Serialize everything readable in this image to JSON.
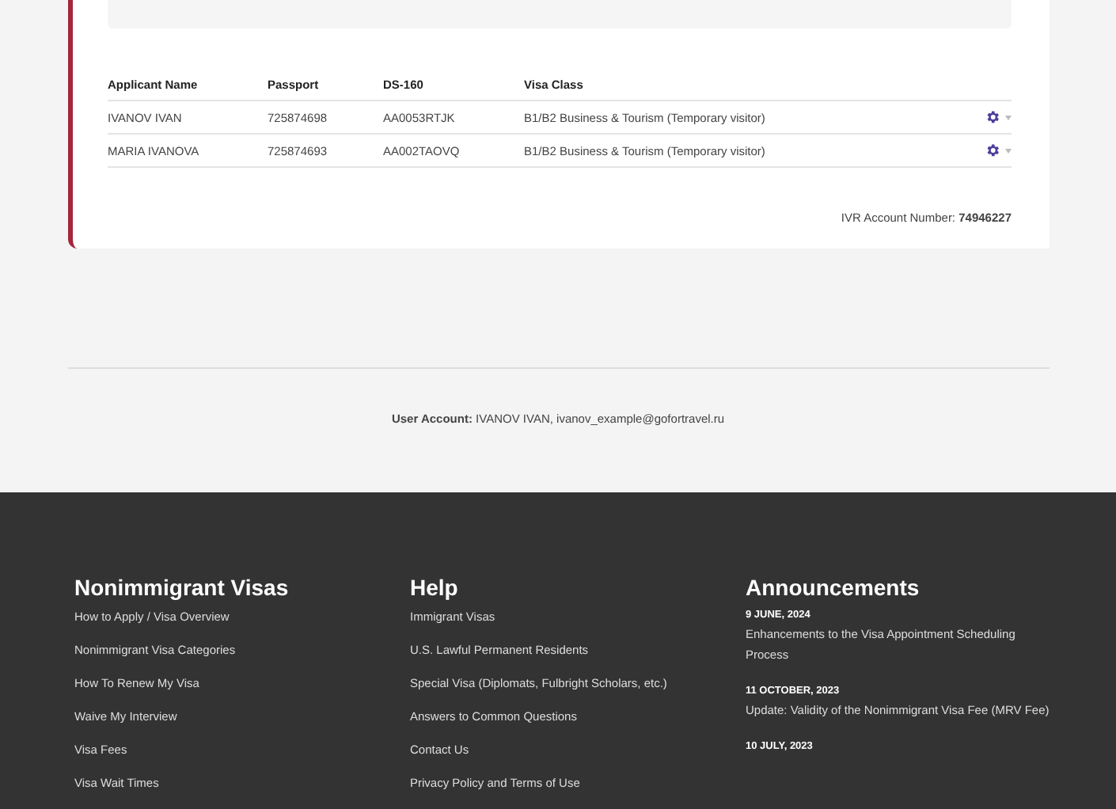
{
  "table": {
    "columns": [
      "Applicant Name",
      "Passport",
      "DS-160",
      "Visa Class"
    ],
    "rows": [
      {
        "cells": [
          "IVANOV IVAN",
          "725874698",
          "AA0053RTJK",
          "B1/B2 Business & Tourism (Temporary visitor)"
        ]
      },
      {
        "cells": [
          "MARIA IVANOVA",
          "725874693",
          "AA002TAOVQ",
          "B1/B2 Business & Tourism (Temporary visitor)"
        ]
      }
    ]
  },
  "ivr": {
    "label": "IVR Account Number:",
    "value": "74946227"
  },
  "user_account": {
    "label": "User Account:",
    "value": "IVANOV IVAN, ivanov_example@gofortravel.ru"
  },
  "footer": {
    "columns": [
      {
        "title": "Nonimmigrant Visas",
        "links": [
          "How to Apply / Visa Overview",
          "Nonimmigrant Visa Categories",
          "How To Renew My Visa",
          "Waive My Interview",
          "Visa Fees",
          "Visa Wait Times"
        ]
      },
      {
        "title": "Help",
        "links": [
          "Immigrant Visas",
          "U.S. Lawful Permanent Residents",
          "Special Visa (Diplomats, Fulbright Scholars, etc.)",
          "Answers to Common Questions",
          "Contact Us",
          "Privacy Policy and Terms of Use"
        ]
      }
    ],
    "announcements": {
      "title": "Announcements",
      "items": [
        {
          "date": "9 JUNE, 2024",
          "text": "Enhancements to the Visa Appointment Scheduling Process"
        },
        {
          "date": "11 OCTOBER, 2023",
          "text": "Update: Validity of the Nonimmigrant Visa Fee (MRV Fee)"
        },
        {
          "date": "10 JULY, 2023"
        }
      ]
    }
  }
}
